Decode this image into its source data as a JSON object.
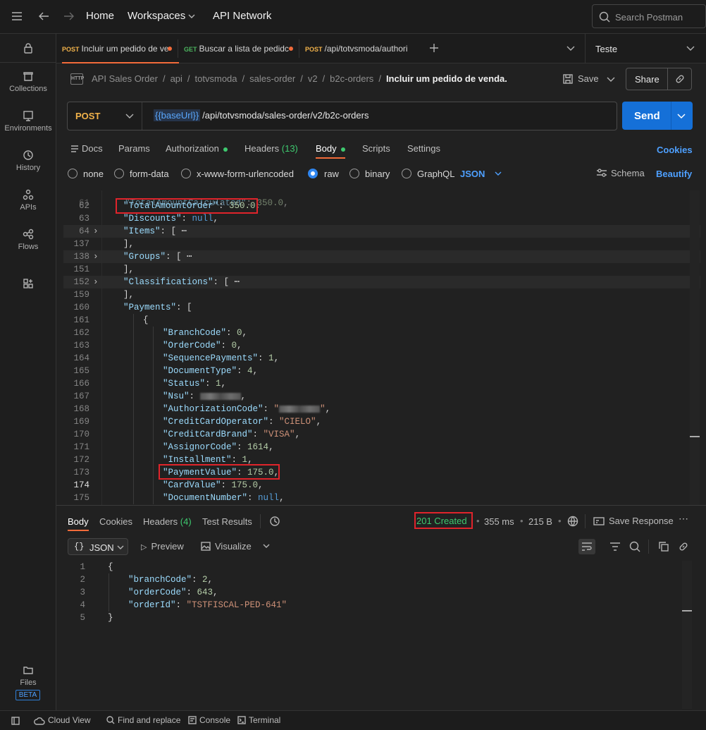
{
  "topbar": {
    "home": "Home",
    "workspaces": "Workspaces",
    "api_network": "API Network",
    "search_placeholder": "Search Postman"
  },
  "sidebar": {
    "items": [
      {
        "label": "Collections"
      },
      {
        "label": "Environments"
      },
      {
        "label": "History"
      },
      {
        "label": "APIs"
      },
      {
        "label": "Flows"
      }
    ],
    "files": "Files",
    "beta": "BETA"
  },
  "tabs": [
    {
      "method": "POST",
      "label": "Incluir um pedido de ve"
    },
    {
      "method": "GET",
      "label": "Buscar a lista de pedidc"
    },
    {
      "method": "POST",
      "label": "/api/totvsmoda/authori"
    }
  ],
  "environment": "Teste",
  "breadcrumb": [
    "API Sales Order",
    "api",
    "totvsmoda",
    "sales-order",
    "v2",
    "b2c-orders"
  ],
  "breadcrumb_current": "Incluir um pedido de venda.",
  "actions": {
    "save": "Save",
    "share": "Share"
  },
  "request": {
    "method": "POST",
    "base_var": "{{baseUrl}}",
    "path": "/api/totvsmoda/sales-order/v2/b2c-orders",
    "send": "Send"
  },
  "req_tabs": {
    "docs": "Docs",
    "params": "Params",
    "authorization": "Authorization",
    "headers": "Headers",
    "headers_count": "(13)",
    "body": "Body",
    "scripts": "Scripts",
    "settings": "Settings",
    "cookies": "Cookies"
  },
  "body_types": {
    "none": "none",
    "form_data": "form-data",
    "urlencoded": "x-www-form-urlencoded",
    "raw": "raw",
    "binary": "binary",
    "graphql": "GraphQL",
    "format": "JSON",
    "schema": "Schema",
    "beautify": "Beautify"
  },
  "editor_lines": [
    {
      "n": "62",
      "key": "\"TotalAmountOrder\"",
      "val": "350.0",
      "type": "num"
    },
    {
      "n": "63",
      "key": "\"Discounts\"",
      "val": "null",
      "type": "kw"
    },
    {
      "n": "64",
      "key": "\"Items\"",
      "val": "[ ⋯",
      "type": "fold"
    },
    {
      "n": "137",
      "key": "",
      "val": "],",
      "type": "punct"
    },
    {
      "n": "138",
      "key": "\"Groups\"",
      "val": "[ ⋯",
      "type": "fold"
    },
    {
      "n": "151",
      "key": "",
      "val": "],",
      "type": "punct"
    },
    {
      "n": "152",
      "key": "\"Classifications\"",
      "val": "[ ⋯",
      "type": "fold"
    },
    {
      "n": "159",
      "key": "",
      "val": "],",
      "type": "punct"
    },
    {
      "n": "160",
      "key": "\"Payments\"",
      "val": "[",
      "type": "open"
    },
    {
      "n": "161",
      "key": "",
      "val": "{",
      "type": "punct"
    },
    {
      "n": "162",
      "key": "\"BranchCode\"",
      "val": "0",
      "type": "num"
    },
    {
      "n": "163",
      "key": "\"OrderCode\"",
      "val": "0",
      "type": "num"
    },
    {
      "n": "164",
      "key": "\"SequencePayments\"",
      "val": "1",
      "type": "num"
    },
    {
      "n": "165",
      "key": "\"DocumentType\"",
      "val": "4",
      "type": "num"
    },
    {
      "n": "166",
      "key": "\"Status\"",
      "val": "1",
      "type": "num"
    },
    {
      "n": "167",
      "key": "\"Nsu\"",
      "val": "",
      "type": "blur"
    },
    {
      "n": "168",
      "key": "\"AuthorizationCode\"",
      "val": "\"",
      "type": "blurstr"
    },
    {
      "n": "169",
      "key": "\"CreditCardOperator\"",
      "val": "\"CIELO\"",
      "type": "str"
    },
    {
      "n": "170",
      "key": "\"CreditCardBrand\"",
      "val": "\"VISA\"",
      "type": "str"
    },
    {
      "n": "171",
      "key": "\"AssignorCode\"",
      "val": "1614",
      "type": "num"
    },
    {
      "n": "172",
      "key": "\"Installment\"",
      "val": "1",
      "type": "num"
    },
    {
      "n": "173",
      "key": "\"PaymentValue\"",
      "val": "175.0",
      "type": "num"
    },
    {
      "n": "174",
      "key": "\"CardValue\"",
      "val": "175.0",
      "type": "num"
    },
    {
      "n": "175",
      "key": "\"DocumentNumber\"",
      "val": "null",
      "type": "kw"
    }
  ],
  "response": {
    "tabs": {
      "body": "Body",
      "cookies": "Cookies",
      "headers": "Headers",
      "headers_count": "(4)",
      "test_results": "Test Results"
    },
    "status": "201 Created",
    "time": "355 ms",
    "size": "215 B",
    "save_response": "Save Response",
    "format": "JSON",
    "preview": "Preview",
    "visualize": "Visualize",
    "lines": [
      {
        "n": "1",
        "text": "{"
      },
      {
        "n": "2",
        "key": "\"branchCode\"",
        "val": "2",
        "type": "num"
      },
      {
        "n": "3",
        "key": "\"orderCode\"",
        "val": "643",
        "type": "num"
      },
      {
        "n": "4",
        "key": "\"orderId\"",
        "val": "\"TSTFISCAL-PED-641\"",
        "type": "str"
      },
      {
        "n": "5",
        "text": "}"
      }
    ]
  },
  "footer": {
    "cloud_view": "Cloud View",
    "find_replace": "Find and replace",
    "console": "Console",
    "terminal": "Terminal"
  }
}
